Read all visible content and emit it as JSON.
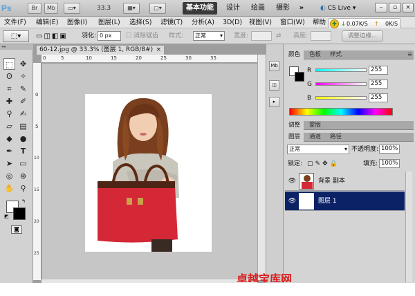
{
  "app": {
    "logo": "Ps",
    "bridge_btn": "Br",
    "minibridge_btn": "Mb",
    "zoom": "33.3",
    "workspaces": [
      "基本功能",
      "设计",
      "绘画",
      "摄影"
    ],
    "more": "»",
    "cs_live": "CS Live"
  },
  "menu": [
    "文件(F)",
    "编辑(E)",
    "图像(I)",
    "图层(L)",
    "选择(S)",
    "滤镜(T)",
    "分析(A)",
    "3D(D)",
    "视图(V)",
    "窗口(W)",
    "帮助"
  ],
  "speed": {
    "down": "0.07K/S",
    "up": "0K/S"
  },
  "options": {
    "feather_label": "羽化:",
    "feather_value": "0 px",
    "antialias_label": "消除锯齿",
    "style_label": "样式:",
    "style_value": "正常",
    "width_label": "宽度:",
    "height_label": "高度:",
    "refine_edge_button": "调整边缘..."
  },
  "document": {
    "tab_title": "60-12.jpg @ 33.3% (图层 1, RGB/8#)",
    "close": "×",
    "ruler_top": [
      "0",
      "5",
      "10",
      "15",
      "20",
      "25",
      "30",
      "35"
    ],
    "ruler_left": [
      "0",
      "5",
      "10",
      "15",
      "20",
      "25"
    ]
  },
  "color_panel": {
    "tabs": [
      "颜色",
      "色板",
      "样式"
    ],
    "channels": [
      {
        "label": "R",
        "value": "255"
      },
      {
        "label": "G",
        "value": "255"
      },
      {
        "label": "B",
        "value": "255"
      }
    ]
  },
  "adjust_panel": {
    "tabs": [
      "调整",
      "蒙版"
    ]
  },
  "layers_panel": {
    "tabs": [
      "图层",
      "通道",
      "路径"
    ],
    "blend_mode": "正常",
    "opacity_label": "不透明度:",
    "opacity_value": "100%",
    "lock_label": "锁定:",
    "fill_label": "填充:",
    "fill_value": "100%",
    "layers": [
      {
        "name": "背景 副本",
        "selected": false
      },
      {
        "name": "图层 1",
        "selected": true
      }
    ]
  },
  "watermark": "卓越宝库网",
  "colors": {
    "selection": "#0b2266",
    "bag": "#d42836",
    "app_bg": "#d4d4d4"
  }
}
